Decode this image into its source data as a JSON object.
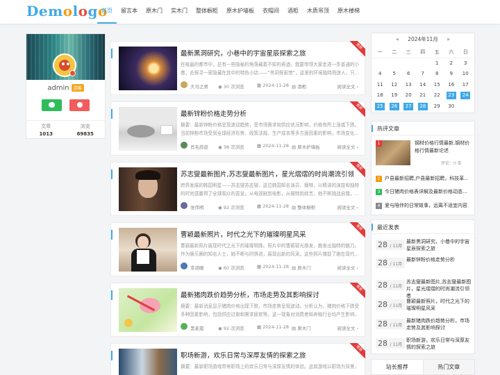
{
  "header": {
    "logo": "Demologo",
    "nav": [
      "首页",
      "留言本",
      "原木门",
      "实木门",
      "整体橱柜",
      "原木护墙板",
      "衣帽间",
      "酒柜",
      "木质吊顶",
      "原木楼梯"
    ]
  },
  "profile": {
    "name": "admin",
    "badge": "游客",
    "stats": [
      {
        "label": "文章",
        "value": "1013"
      },
      {
        "label": "浏览",
        "value": "69835"
      }
    ]
  },
  "articles": [
    {
      "title": "最新黑洞研究，小巷中的宇宙星辰探索之旅",
      "excerpt": "在喧嚣的都市中，总有一些隐秘的角落藏着不知的奇迹。我要带领大家走进一条普通的小巷，去探寻一家隐藏在其中的特色小店——“黑洞探索馆”，这里的环境独特而迷人，只...",
      "author": "大马之男",
      "views": "30 次浏览",
      "date": "2024-11-28",
      "category": "酒柜",
      "more": "阅读全文",
      "ribbon": "推荐"
    },
    {
      "title": "最新锌粉价格走势分析",
      "excerpt": "摘要：最新锌粉价格呈现波动趋势，受市场需求和供应状况影响，价格有所上涨或下跌。当前锌粉市场受到全球经济形势、政策法规、生产成本等多方面因素的影响，市场变化...",
      "author": "肖毛蒜皮",
      "views": "38 次浏览",
      "date": "2024-11-28",
      "category": "原木护墙板",
      "more": "阅读全文",
      "ribbon": "推荐"
    },
    {
      "title": "苏志燮最新图片,苏志燮最新图片，星光熠熠的时尚潮流引领者",
      "excerpt": "跨界发展的韩国明星——苏志燮苏志燮，这位韩国知名演员、模特，以精湛的演技和独特的时尚感赢得了全球观众的喜爱。从电视剧到电影，从模特到综艺，他不断挑战自我，...",
      "author": "张伟明",
      "views": "92 次浏览",
      "date": "2024-11-28",
      "category": "整体橱柜",
      "more": "阅读全文",
      "ribbon": "推荐"
    },
    {
      "title": "曹颖最新照片，时代之光下的璀璨明星风采",
      "excerpt": "曹颖最新照片展现时代之光下的璀璨明珠。照片中的曹颖容光焕发，散发出独特的魅力。作为娱乐圈的知名人士，她不断与时俱进，展现出新的风采。这些照片捕捉了她在现代...",
      "author": "幸涵暖",
      "views": "60 次浏览",
      "date": "2024-11-28",
      "category": "原木门",
      "more": "阅读全文",
      "ribbon": "推荐"
    },
    {
      "title": "最新猪肉跌价趋势分析，市场走势及其影响探讨",
      "excerpt": "摘要：最新消息显示猪肉价格出现下跌，市场走势呈现波动。分析认为，猪肉价格下跌受多种因素影响，包括供应过剩和需求疲软等。这一现象对消费者和养殖行业均产生影响...",
      "author": "黑麦旋",
      "views": "92 次浏览",
      "date": "2024-11-28",
      "category": "原木门",
      "more": "阅读全文",
      "ribbon": "推荐"
    },
    {
      "title": "职场新游，欢乐日常与深厚友情的探索之旅",
      "excerpt": "摘要：最新职场游戏带来职场上的欢乐日常与深厚友情的体验。这款游戏以职场为背景，带你走入一个充满挑战与机遇的虚拟世界...",
      "author": "",
      "views": "",
      "date": "",
      "category": "",
      "more": "",
      "ribbon": "推荐"
    }
  ],
  "calendar": {
    "prev": "«",
    "title": "2024年11月",
    "next": "»",
    "weekdays": [
      "一",
      "二",
      "三",
      "四",
      "五",
      "六",
      "日"
    ],
    "weeks": [
      [
        "",
        "",
        "",
        "",
        "1",
        "2",
        "3"
      ],
      [
        "4",
        "5",
        "6",
        "7",
        "8",
        "9",
        "10"
      ],
      [
        "11",
        "12",
        "13",
        "14",
        "15",
        "16",
        "17"
      ],
      [
        "18",
        "19",
        "20",
        "21",
        "22",
        "23",
        "24"
      ],
      [
        "25",
        "26",
        "27",
        "28",
        "29",
        "30",
        ""
      ]
    ],
    "highlighted": [
      "23",
      "24",
      "25",
      "26",
      "27",
      "28"
    ]
  },
  "hot": {
    "title": "热评文章",
    "first": {
      "num": "1",
      "title": "钢材价格行情最新,钢材价格行情最新论述",
      "meta": "评论：0 条"
    },
    "items": [
      {
        "num": "2",
        "title": "户县最新招聘,户县最新招聘，科技革..."
      },
      {
        "num": "3",
        "title": "今日猪肉价格表详解及最新价格动态..."
      },
      {
        "num": "4",
        "title": "爱与陪伴的日常故事，远离不适宜内容"
      }
    ]
  },
  "recent": {
    "title": "最近发表",
    "items": [
      {
        "day": "28",
        "month": "/ 11月",
        "title": "最新黑洞研究，小巷中的宇宙星辰探索之旅"
      },
      {
        "day": "28",
        "month": "/ 11月",
        "title": "最新锌粉价格走势分析"
      },
      {
        "day": "28",
        "month": "/ 11月",
        "title": "苏志燮最新图片,苏志燮最新图片，星光熠熠的时尚潮流引领者"
      },
      {
        "day": "28",
        "month": "/ 11月",
        "title": "曹颖最新照片，时代之光下的璀璨明星风采"
      },
      {
        "day": "28",
        "month": "/ 11月",
        "title": "最新猪肉跌价趋势分析，市场走势及其影响探讨"
      },
      {
        "day": "28",
        "month": "/ 11月",
        "title": "职场新游，欢乐日常与深厚友情的探索之旅"
      }
    ]
  },
  "tabs": [
    "站长推荐",
    "热门文章"
  ]
}
